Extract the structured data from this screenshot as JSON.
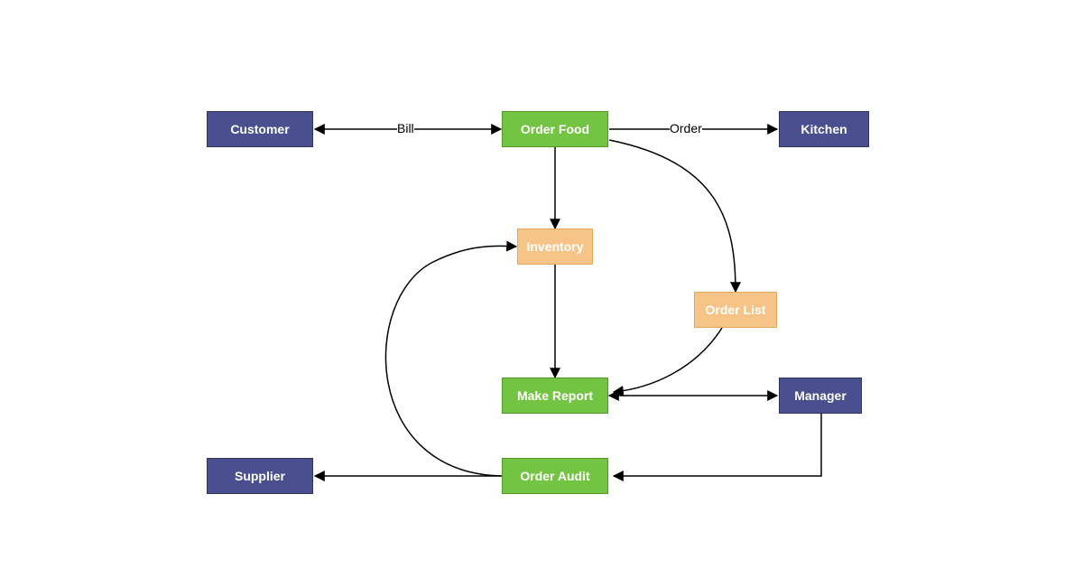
{
  "nodes": {
    "customer": {
      "label": "Customer",
      "type": "purple"
    },
    "order_food": {
      "label": "Order Food",
      "type": "green"
    },
    "kitchen": {
      "label": "Kitchen",
      "type": "purple"
    },
    "inventory": {
      "label": "Inventory",
      "type": "orange"
    },
    "order_list": {
      "label": "Order List",
      "type": "orange"
    },
    "make_report": {
      "label": "Make Report",
      "type": "green"
    },
    "manager": {
      "label": "Manager",
      "type": "purple"
    },
    "supplier": {
      "label": "Supplier",
      "type": "purple"
    },
    "order_audit": {
      "label": "Order Audit",
      "type": "green"
    }
  },
  "edge_labels": {
    "bill": "Bill",
    "order": "Order"
  },
  "colors": {
    "purple": "#4a508f",
    "green": "#74c444",
    "orange": "#f7c488",
    "arrow": "#000000"
  },
  "diagram_edges": [
    {
      "from": "order_food",
      "to": "customer",
      "label": "Bill",
      "bidirectional": true
    },
    {
      "from": "order_food",
      "to": "kitchen",
      "label": "Order",
      "bidirectional": false
    },
    {
      "from": "order_food",
      "to": "inventory",
      "bidirectional": false
    },
    {
      "from": "order_food",
      "to": "order_list",
      "bidirectional": false,
      "curve": true
    },
    {
      "from": "inventory",
      "to": "make_report",
      "bidirectional": false
    },
    {
      "from": "order_list",
      "to": "make_report",
      "bidirectional": false,
      "curve": true
    },
    {
      "from": "make_report",
      "to": "manager",
      "bidirectional": true
    },
    {
      "from": "manager",
      "to": "order_audit",
      "bidirectional": false
    },
    {
      "from": "order_audit",
      "to": "inventory",
      "bidirectional": false,
      "curve": true
    },
    {
      "from": "order_audit",
      "to": "supplier",
      "bidirectional": false
    }
  ]
}
